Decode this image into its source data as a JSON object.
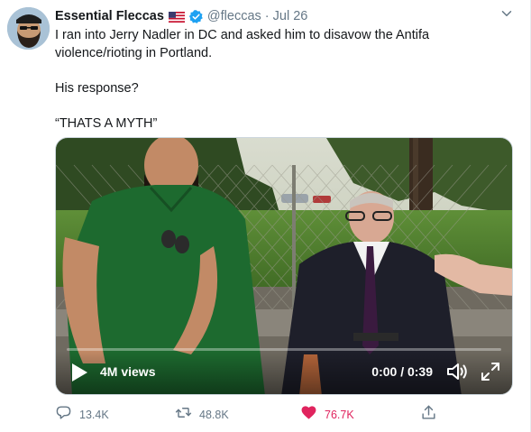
{
  "author": {
    "display_name": "Essential Fleccas",
    "handle": "@fleccas",
    "separator": "·",
    "date": "Jul 26",
    "flag": "us-flag-icon",
    "verified": true,
    "colors": {
      "verified": "#1da1f2"
    }
  },
  "tweet": {
    "line1": "I ran into Jerry Nadler in DC and asked him to disavow the Antifa violence/rioting in Portland.",
    "line2": "His response?",
    "line3": "“THATS A MYTH”"
  },
  "video": {
    "views": "4M views",
    "time": "0:00 / 0:39",
    "progress": 0,
    "icons": [
      "play-icon",
      "volume-icon",
      "fullscreen-icon"
    ]
  },
  "actions": {
    "replies": "13.4K",
    "retweets": "48.8K",
    "likes": "76.7K",
    "liked": true,
    "colors": {
      "like": "#e0245e",
      "muted": "#657786"
    }
  }
}
